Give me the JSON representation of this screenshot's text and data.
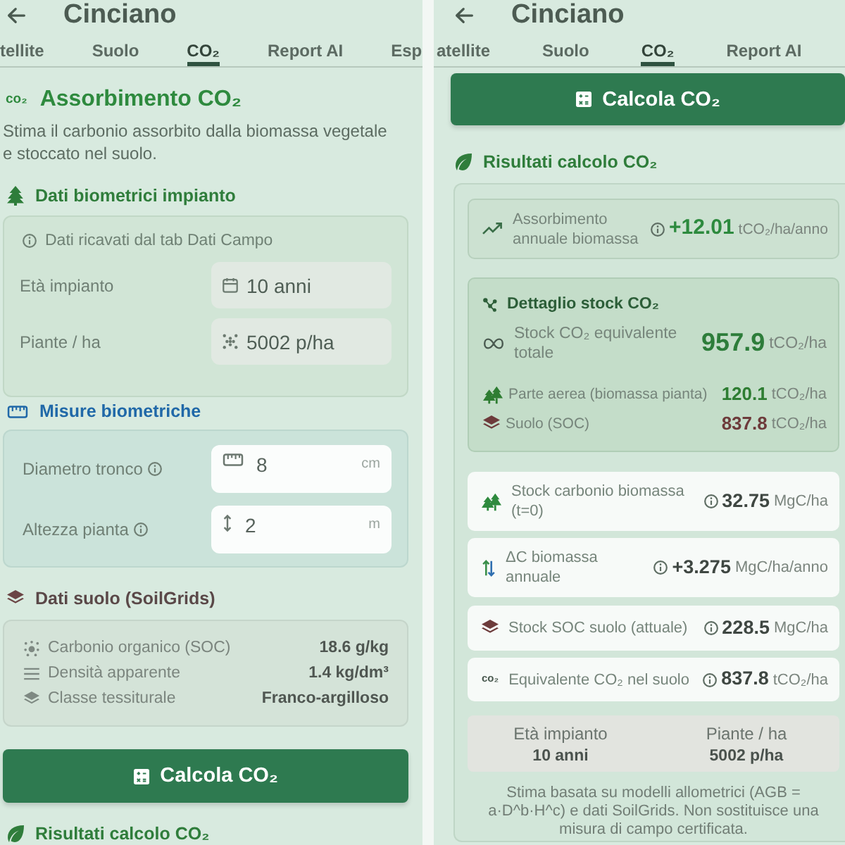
{
  "left_screen": {
    "title": "Cinciano",
    "tabs": [
      {
        "label": "tellite",
        "selected": false
      },
      {
        "label": "Suolo",
        "selected": false
      },
      {
        "label": "CO₂",
        "selected": true
      },
      {
        "label": "Report AI",
        "selected": false
      },
      {
        "label": "Esp",
        "selected": false
      }
    ],
    "intro": {
      "icon_text": "co₂",
      "heading": "Assorbimento CO₂",
      "description": "Stima il carbonio assorbito dalla biomassa vegetale e stoccato nel suolo."
    },
    "plant_data": {
      "heading": "Dati biometrici impianto",
      "note": "Dati ricavati dal tab Dati Campo",
      "fields": [
        {
          "label": "Età impianto",
          "value": "10 anni"
        },
        {
          "label": "Piante / ha",
          "value": "5002 p/ha"
        }
      ]
    },
    "measurements": {
      "heading": "Misure biometriche",
      "fields": [
        {
          "label": "Diametro tronco",
          "value": "8",
          "unit": "cm"
        },
        {
          "label": "Altezza pianta",
          "value": "2",
          "unit": "m"
        }
      ]
    },
    "soil_data": {
      "heading": "Dati suolo (SoilGrids)",
      "rows": [
        {
          "label": "Carbonio organico (SOC)",
          "value": "18.6 g/kg"
        },
        {
          "label": "Densità apparente",
          "value": "1.4 kg/dm³"
        },
        {
          "label": "Classe tessiturale",
          "value": "Franco-argilloso"
        }
      ]
    },
    "calculate_button": "Calcola CO₂",
    "results_heading": "Risultati calcolo CO₂"
  },
  "right_screen": {
    "title": "Cinciano",
    "tabs": [
      {
        "label": "atellite",
        "selected": false
      },
      {
        "label": "Suolo",
        "selected": false
      },
      {
        "label": "CO₂",
        "selected": true
      },
      {
        "label": "Report AI",
        "selected": false
      }
    ],
    "calculate_button": "Calcola CO₂",
    "results_heading": "Risultati calcolo CO₂",
    "annual_absorption": {
      "label": "Assorbimento annuale biomassa",
      "value": "+12.01",
      "unit": "tCO₂/ha/anno"
    },
    "stock_detail": {
      "heading": "Dettaglio stock CO₂",
      "total": {
        "label": "Stock CO₂ equivalente totale",
        "value": "957.9",
        "unit": "tCO₂/ha"
      },
      "parts": [
        {
          "label": "Parte aerea (biomassa pianta)",
          "value": "120.1",
          "unit": "tCO₂/ha",
          "color": "#2e7d32"
        },
        {
          "label": "Suolo (SOC)",
          "value": "837.8",
          "unit": "tCO₂/ha",
          "color": "#6d3b3b"
        }
      ]
    },
    "metrics": [
      {
        "label": "Stock carbonio biomassa (t=0)",
        "value": "32.75",
        "unit": "MgC/ha"
      },
      {
        "label": "ΔC biomassa annuale",
        "value": "+3.275",
        "unit": "MgC/ha/anno"
      },
      {
        "label": "Stock SOC suolo (attuale)",
        "value": "228.5",
        "unit": "MgC/ha"
      },
      {
        "icon_text": "co₂",
        "label": "Equivalente CO₂ nel suolo",
        "value": "837.8",
        "unit": "tCO₂/ha"
      }
    ],
    "summary": [
      {
        "label": "Età impianto",
        "value": "10 anni"
      },
      {
        "label": "Piante / ha",
        "value": "5002 p/ha"
      }
    ],
    "footnote": "Stima basata su modelli allometrici (AGB = a·D^b·H^c) e dati SoilGrids. Non sostituisce una misura di campo certificata."
  }
}
